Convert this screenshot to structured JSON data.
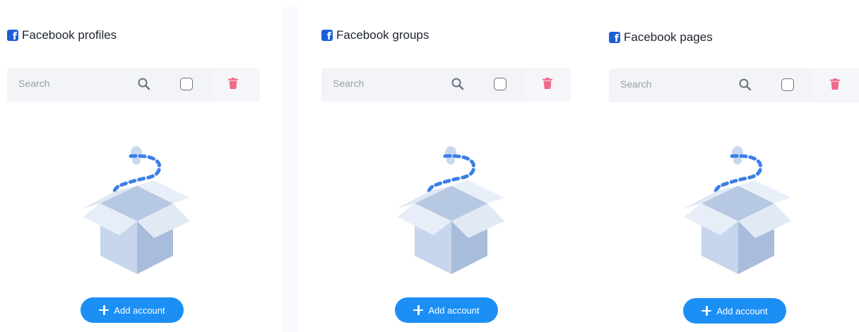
{
  "panels": [
    {
      "title": "Facebook profiles",
      "search_placeholder": "Search",
      "add_label": "Add account"
    },
    {
      "title": "Facebook groups",
      "search_placeholder": "Search",
      "add_label": "Add account"
    },
    {
      "title": "Facebook pages",
      "search_placeholder": "Search",
      "add_label": "Add account"
    }
  ],
  "colors": {
    "brand_blue": "#1b5fd6",
    "button_blue": "#1c8ff5",
    "trash_pink": "#f06a8b",
    "search_bg": "#f2f4f7"
  },
  "icons": [
    "facebook-icon",
    "search-icon",
    "checkbox",
    "trash-icon",
    "empty-box-illustration",
    "plus-icon"
  ]
}
